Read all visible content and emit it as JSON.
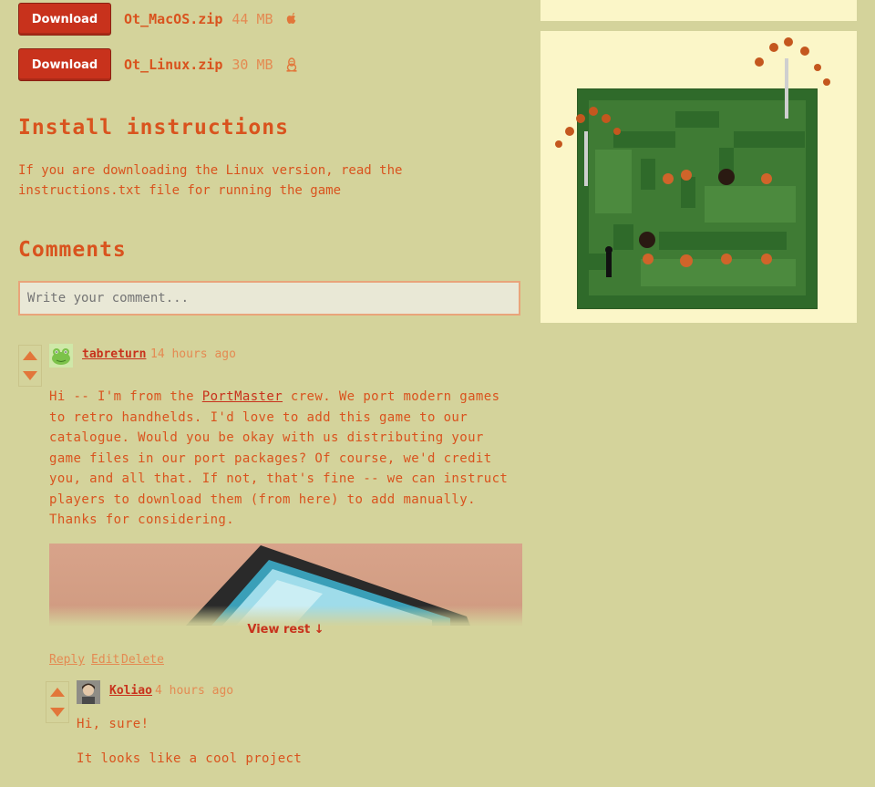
{
  "downloads": [
    {
      "button": "Download",
      "filename": "Ot_MacOS.zip",
      "size": "44 MB",
      "os_icon": "apple-icon"
    },
    {
      "button": "Download",
      "filename": "Ot_Linux.zip",
      "size": "30 MB",
      "os_icon": "linux-icon"
    }
  ],
  "install": {
    "heading": "Install instructions",
    "text": "If you are downloading the Linux version, read the instructions.txt file for running the game"
  },
  "comments": {
    "heading": "Comments",
    "input_placeholder": "Write your comment...",
    "items": [
      {
        "user": "tabreturn",
        "time": "14 hours ago",
        "body_before_link": "Hi -- I'm from the ",
        "link": "PortMaster",
        "body_after_link": " crew. We port modern games to retro handhelds. I'd love to add this game to our catalogue. Would you be okay with us distributing your game files in our port packages? Of course, we'd credit you, and all that. If not, that's fine -- we can instruct players to download them (from here) to add manually. Thanks for considering.",
        "view_rest": "View rest ↓",
        "actions": [
          "Reply",
          "Edit",
          "Delete"
        ]
      },
      {
        "user": "Koliao",
        "time": "4 hours ago",
        "line1": "Hi, sure!",
        "line2": "It looks like a cool project"
      }
    ]
  },
  "colors": {
    "background": "#d4d39b",
    "accent": "#d9531e",
    "button": "#c8321c",
    "panel": "#fbf6c8"
  }
}
